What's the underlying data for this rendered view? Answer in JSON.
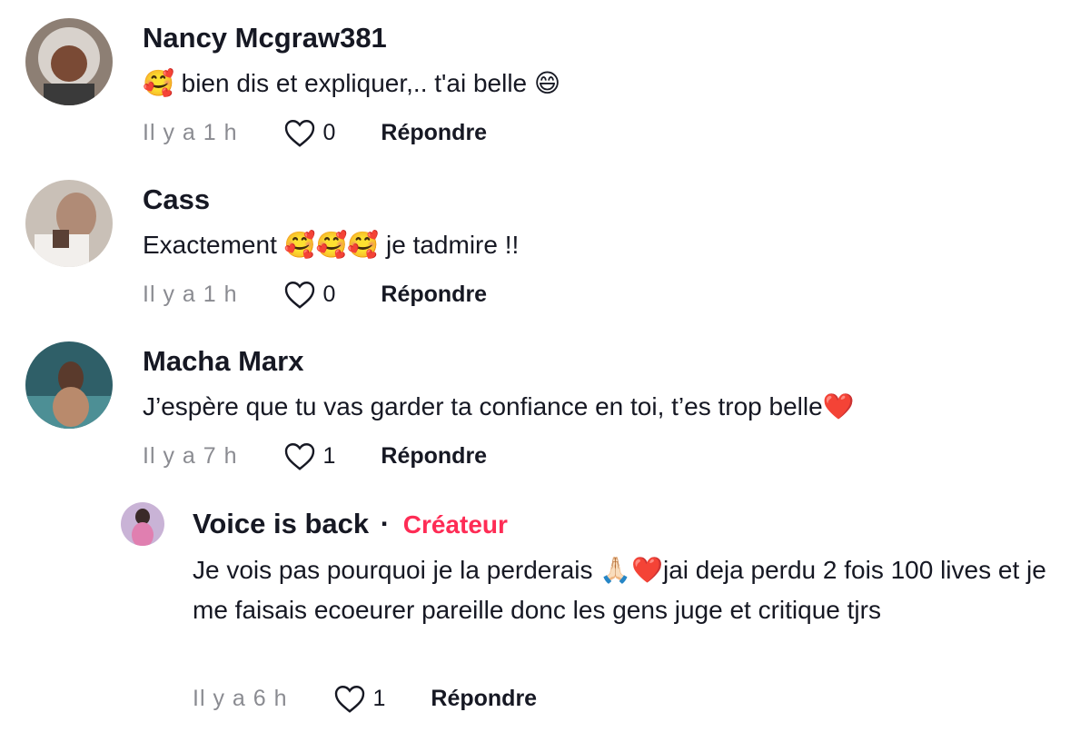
{
  "comments": [
    {
      "username": "Nancy Mcgraw381",
      "text": "🥰 bien dis et expliquer,.. t'ai belle 😄",
      "time": "Il y a 1 h",
      "likes": "0",
      "reply_label": "Répondre"
    },
    {
      "username": "Cass",
      "text": "Exactement 🥰🥰🥰 je tadmire !!",
      "time": "Il y a 1 h",
      "likes": "0",
      "reply_label": "Répondre"
    },
    {
      "username": "Macha Marx",
      "text": "J’espère que tu vas garder ta confiance en toi, t’es trop belle❤️",
      "time": "Il y a 7 h",
      "likes": "1",
      "reply_label": "Répondre"
    }
  ],
  "reply": {
    "username": "Voice is back",
    "separator": "·",
    "badge": "Créateur",
    "text": "Je vois pas pourquoi je la perderais 🙏🏻❤️jai deja perdu 2 fois 100 lives et je me faisais ecoeurer pareille donc les gens juge et critique tjrs",
    "time": "Il y a 6 h",
    "likes": "1",
    "reply_label": "Répondre"
  },
  "colors": {
    "creator_badge": "#fe2c55",
    "meta_text": "#8a8b91",
    "primary_text": "#161823"
  },
  "icons": {
    "like": "heart-outline-icon"
  }
}
